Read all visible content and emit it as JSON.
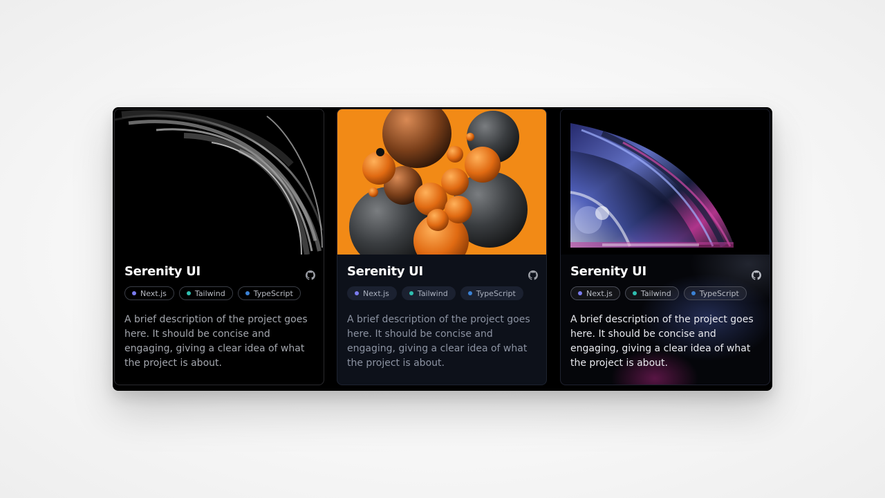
{
  "cards": [
    {
      "title": "Serenity UI",
      "github_icon": "github-icon",
      "tags": [
        {
          "label": "Next.js",
          "color": "#7b7cf0"
        },
        {
          "label": "Tailwind",
          "color": "#2fbfb0"
        },
        {
          "label": "TypeScript",
          "color": "#3b82d6"
        }
      ],
      "description": "A brief description of the project goes here. It should be concise and engaging, giving a clear idea of what the project is about.",
      "image": "chrome-swirl-image"
    },
    {
      "title": "Serenity UI",
      "github_icon": "github-icon",
      "tags": [
        {
          "label": "Next.js",
          "color": "#7b7cf0"
        },
        {
          "label": "Tailwind",
          "color": "#2fbfb0"
        },
        {
          "label": "TypeScript",
          "color": "#3b82d6"
        }
      ],
      "description": "A brief description of the project goes here. It should be concise and engaging, giving a clear idea of what the project is about.",
      "image": "orange-spheres-image"
    },
    {
      "title": "Serenity UI",
      "github_icon": "github-icon",
      "tags": [
        {
          "label": "Next.js",
          "color": "#7b7cf0"
        },
        {
          "label": "Tailwind",
          "color": "#2fbfb0"
        },
        {
          "label": "TypeScript",
          "color": "#3b82d6"
        }
      ],
      "description": "A brief description of the project goes here. It should be concise and engaging, giving a clear idea of what the project is about.",
      "image": "iridescent-wave-image"
    }
  ]
}
